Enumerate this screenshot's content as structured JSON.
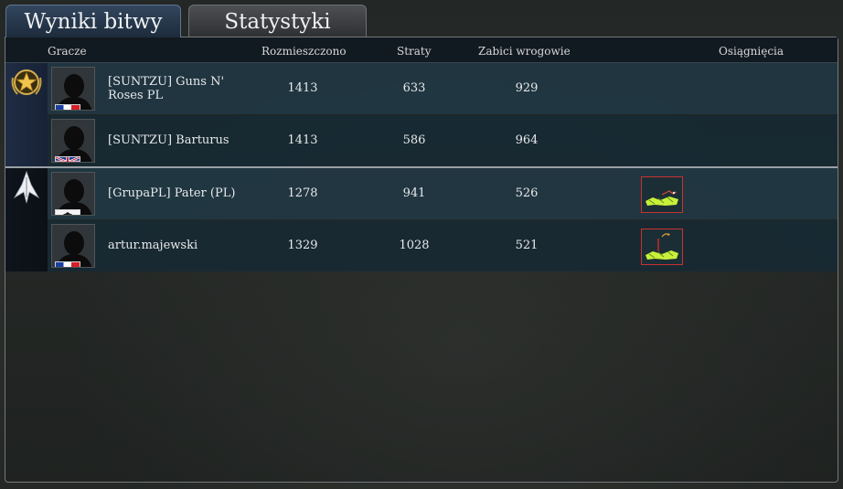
{
  "tabs": [
    {
      "label": "Wyniki bitwy"
    },
    {
      "label": "Statystyki"
    }
  ],
  "columns": {
    "players": "Gracze",
    "deployed": "Rozmieszczono",
    "losses": "Straty",
    "kills": "Zabici wrogowie",
    "achievements": "Osiągnięcia"
  },
  "teams": [
    {
      "icon": "gold-star-emblem-icon",
      "players": [
        {
          "name": "[SUNTZU] Guns N' Roses PL",
          "flag": "france-flag-icon",
          "deployed": "1413",
          "losses": "633",
          "kills": "929",
          "achievement": ""
        },
        {
          "name": "[SUNTZU] Barturus",
          "flag": "uk-flag-icon",
          "deployed": "1413",
          "losses": "586",
          "kills": "964",
          "achievement": ""
        }
      ]
    },
    {
      "icon": "white-arrow-emblem-icon",
      "players": [
        {
          "name": "[GrupaPL] Pater (PL)",
          "flag": "prussia-flag-icon",
          "deployed": "1278",
          "losses": "941",
          "kills": "526",
          "achievement": "battle-achievement-icon"
        },
        {
          "name": "artur.majewski",
          "flag": "france-flag-icon",
          "deployed": "1329",
          "losses": "1028",
          "kills": "521",
          "achievement": "artillery-achievement-icon"
        }
      ]
    }
  ],
  "colors": {
    "active_tab": "#1d2b3c",
    "row_light": "#213743",
    "row_dark": "#172933",
    "achievement_border": "#c93232"
  }
}
